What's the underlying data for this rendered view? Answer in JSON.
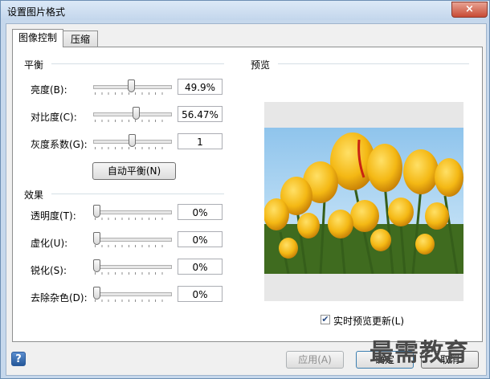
{
  "window": {
    "title": "设置图片格式",
    "close_label": "×"
  },
  "tabs": [
    {
      "label": "图像控制"
    },
    {
      "label": "压缩"
    }
  ],
  "balance": {
    "section": "平衡",
    "brightness": {
      "label": "亮度(B):",
      "value": "49.9%",
      "level": 0.499
    },
    "contrast": {
      "label": "对比度(C):",
      "value": "56.47%",
      "level": 0.5647
    },
    "gamma": {
      "label": "灰度系数(G):",
      "value": "1",
      "level": 0.5
    },
    "auto_button": "自动平衡(N)"
  },
  "effects": {
    "section": "效果",
    "transparency": {
      "label": "透明度(T):",
      "value": "0%",
      "level": 0
    },
    "blur": {
      "label": "虚化(U):",
      "value": "0%",
      "level": 0
    },
    "sharpen": {
      "label": "锐化(S):",
      "value": "0%",
      "level": 0
    },
    "denoise": {
      "label": "去除杂色(D):",
      "value": "0%",
      "level": 0
    }
  },
  "preview": {
    "section": "预览",
    "live_update_label": "实时预览更新(L)",
    "live_update_checked": true,
    "check_glyph": "✔"
  },
  "footer": {
    "help_label": "?",
    "apply_label": "应用(A)",
    "ok_label": "确定",
    "cancel_label": "取消"
  },
  "watermark": "最需教育"
}
